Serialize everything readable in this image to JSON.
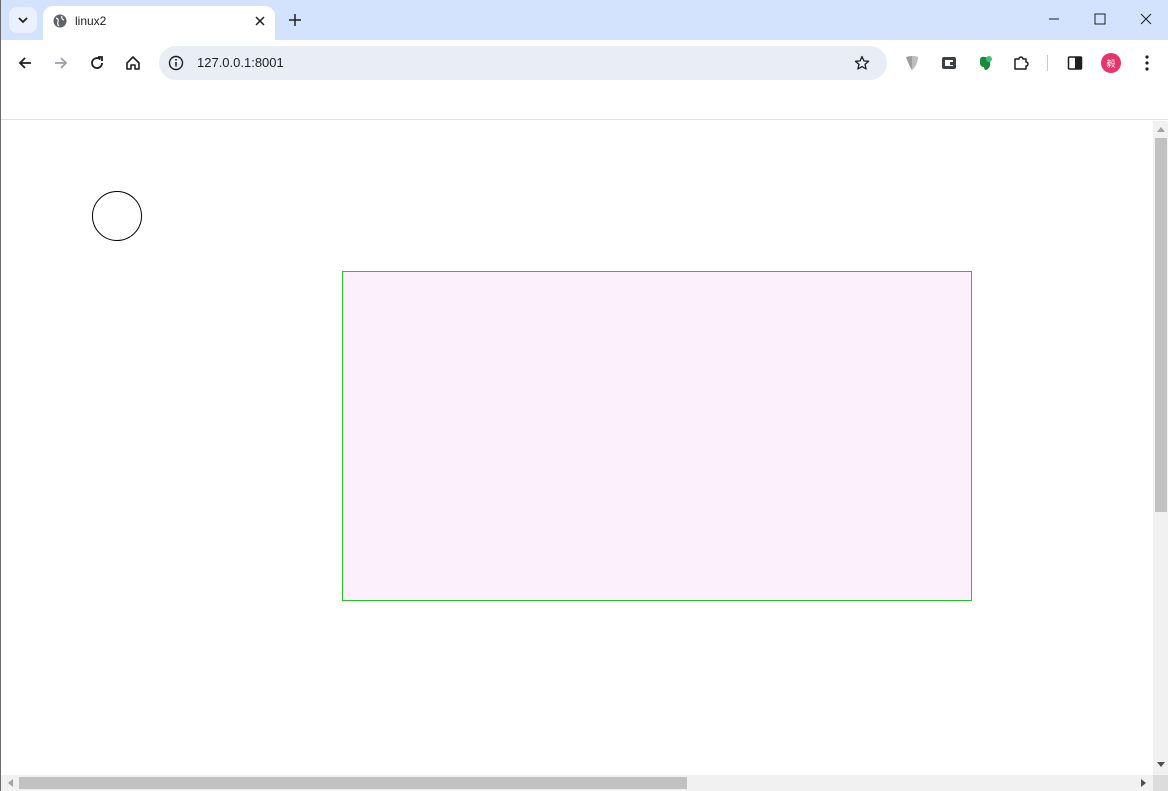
{
  "browser": {
    "tab": {
      "title": "linux2"
    },
    "address_bar": {
      "url": "127.0.0.1:8001"
    },
    "profile": {
      "initial": "毅"
    }
  },
  "icons": {
    "tab_search": "chevron-down-icon",
    "favicon": "globe-icon",
    "tab_close": "close-icon",
    "new_tab": "plus-icon",
    "minimize": "minimize-icon",
    "maximize": "maximize-icon",
    "close_window": "close-icon",
    "back": "back-arrow-icon",
    "forward": "forward-arrow-icon",
    "reload": "reload-icon",
    "home": "home-icon",
    "site_info": "info-icon",
    "bookmark": "star-icon",
    "extensions": [
      "shield-extension-icon",
      "wallet-extension-icon",
      "evernote-icon",
      "puzzle-icon"
    ],
    "side_panel": "side-panel-icon",
    "menu": "kebab-menu-icon"
  },
  "colors": {
    "tabstrip_bg": "#d3e3fd",
    "omnibox_bg": "#e9eef6",
    "rect_fill": "#fdf0fd",
    "rect_border": "#22c522",
    "circle_stroke": "#000000",
    "avatar_bg": "#e8336d"
  }
}
